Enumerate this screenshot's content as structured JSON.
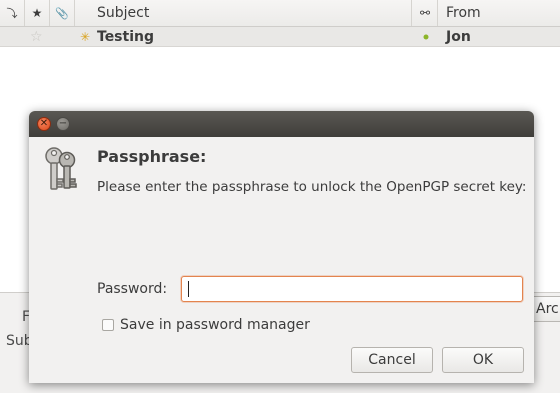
{
  "columns": {
    "thread_icon": "⤵",
    "star_icon": "★",
    "attach_icon": "📎",
    "subject": "Subject",
    "correspondent_icon": "⚯",
    "from": "From"
  },
  "messages": [
    {
      "subject": "Testing",
      "from": "Jon",
      "starred": false,
      "new": true
    }
  ],
  "behind": {
    "label_f": "F",
    "label_subj": "Sub",
    "archive_btn": "Arc"
  },
  "dialog": {
    "title": "Passphrase:",
    "message": "Please enter the passphrase to unlock the OpenPGP secret key:",
    "password_label": "Password:",
    "password_value": "",
    "save_label": "Save in password manager",
    "save_checked": false,
    "cancel": "Cancel",
    "ok": "OK"
  },
  "colors": {
    "titlebar": "#4a4945",
    "close_button": "#e65a2c",
    "focus_border": "#e3844e",
    "online_dot": "#8cb52a"
  }
}
